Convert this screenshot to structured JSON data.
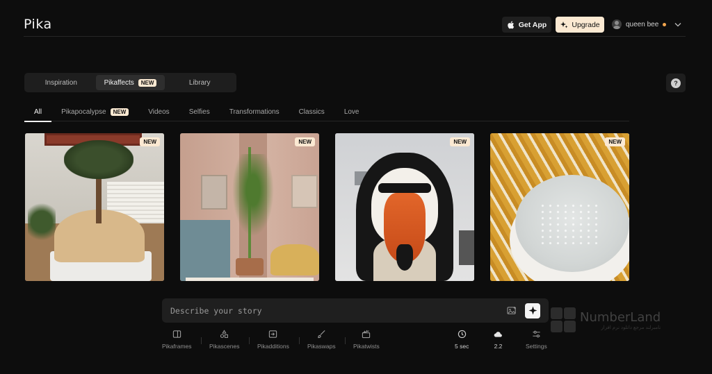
{
  "header": {
    "logo": "Pika",
    "get_app_label": "Get App",
    "upgrade_label": "Upgrade",
    "user_name": "queen bee"
  },
  "main_tabs": [
    {
      "label": "Inspiration",
      "active": false
    },
    {
      "label": "Pikaffects",
      "badge": "NEW",
      "active": true
    },
    {
      "label": "Library",
      "active": false
    }
  ],
  "help_label": "?",
  "sub_tabs": [
    {
      "label": "All",
      "active": true
    },
    {
      "label": "Pikapocalypse",
      "badge": "NEW"
    },
    {
      "label": "Videos"
    },
    {
      "label": "Selfies"
    },
    {
      "label": "Transformations"
    },
    {
      "label": "Classics"
    },
    {
      "label": "Love"
    }
  ],
  "cards": [
    {
      "badge": "NEW",
      "subject": "bonsai-tree"
    },
    {
      "badge": "NEW",
      "subject": "bamboo-room"
    },
    {
      "badge": "NEW",
      "subject": "duck-face-person"
    },
    {
      "badge": "NEW",
      "subject": "bowl-on-pattern"
    }
  ],
  "prompt": {
    "placeholder": "Describe your story"
  },
  "tools": [
    {
      "label": "Pikaframes",
      "icon": "frames-icon"
    },
    {
      "label": "Pikascenes",
      "icon": "shapes-icon"
    },
    {
      "label": "Pikadditions",
      "icon": "add-icon"
    },
    {
      "label": "Pikaswaps",
      "icon": "brush-icon"
    },
    {
      "label": "Pikatwists",
      "icon": "clapper-icon"
    }
  ],
  "settings": [
    {
      "label": "5 sec",
      "icon": "clock-icon"
    },
    {
      "label": "2.2",
      "icon": "cloud-icon"
    },
    {
      "label": "Settings",
      "icon": "sliders-icon"
    }
  ],
  "watermark": {
    "name": "NumberLand",
    "sub": "نامبرلند مرجع دانلود نرم افزار"
  },
  "colors": {
    "background": "#0d0d0d",
    "accent": "#fbe9d2",
    "status_dot": "#f2a64e"
  }
}
